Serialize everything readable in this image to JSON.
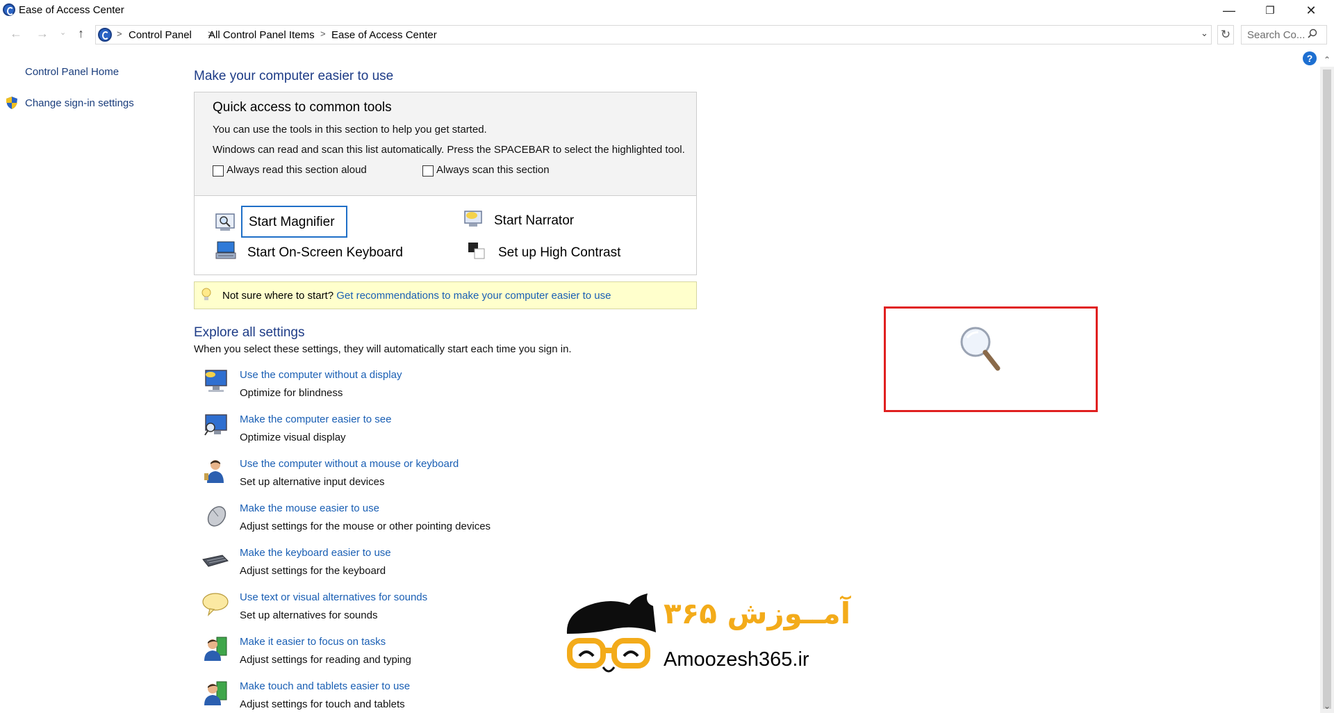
{
  "window": {
    "title": "Ease of Access Center",
    "minimize_glyph": "—",
    "maximize_glyph": "❐",
    "close_glyph": "✕"
  },
  "address_bar": {
    "breadcrumbs": [
      "Control Panel",
      "All Control Panel Items",
      "Ease of Access Center"
    ],
    "separator": ">",
    "search_placeholder": "Search Co..."
  },
  "left_pane": {
    "home_link": "Control Panel Home",
    "signin_link": "Change sign-in settings"
  },
  "main": {
    "heading": "Make your computer easier to use",
    "quick_access": {
      "heading": "Quick access to common tools",
      "line1": "You can use the tools in this section to help you get started.",
      "line2": "Windows can read and scan this list automatically.  Press the SPACEBAR to select the highlighted tool.",
      "checkbox_read_aloud": "Always read this section aloud",
      "checkbox_scan": "Always scan this section",
      "tools": {
        "magnifier": "Start Magnifier",
        "narrator": "Start Narrator",
        "keyboard": "Start On-Screen Keyboard",
        "contrast": "Set up High Contrast"
      }
    },
    "tip": {
      "prefix": "Not sure where to start?",
      "link": "Get recommendations to make your computer easier to use"
    },
    "explore": {
      "heading": "Explore all settings",
      "description": "When you select these settings, they will automatically start each time you sign in.",
      "items": [
        {
          "link": "Use the computer without a display",
          "desc": "Optimize for blindness"
        },
        {
          "link": "Make the computer easier to see",
          "desc": "Optimize visual display"
        },
        {
          "link": "Use the computer without a mouse or keyboard",
          "desc": "Set up alternative input devices"
        },
        {
          "link": "Make the mouse easier to use",
          "desc": "Adjust settings for the mouse or other pointing devices"
        },
        {
          "link": "Make the keyboard easier to use",
          "desc": "Adjust settings for the keyboard"
        },
        {
          "link": "Use text or visual alternatives for sounds",
          "desc": "Set up alternatives for sounds"
        },
        {
          "link": "Make it easier to focus on tasks",
          "desc": "Adjust settings for reading and typing"
        },
        {
          "link": "Make touch and tablets easier to use",
          "desc": "Adjust settings for touch and tablets"
        }
      ]
    }
  },
  "watermark": {
    "latin": "Amoozesh365.ir",
    "farsi": "آمــوزش ۳۶۵"
  },
  "colors": {
    "link": "#1a5fb4",
    "heading": "#1e3c87",
    "highlight_border": "#1f6fc7",
    "annotation": "#e02020",
    "tip_background": "#ffffcc",
    "watermark_accent": "#f3ab1a"
  }
}
